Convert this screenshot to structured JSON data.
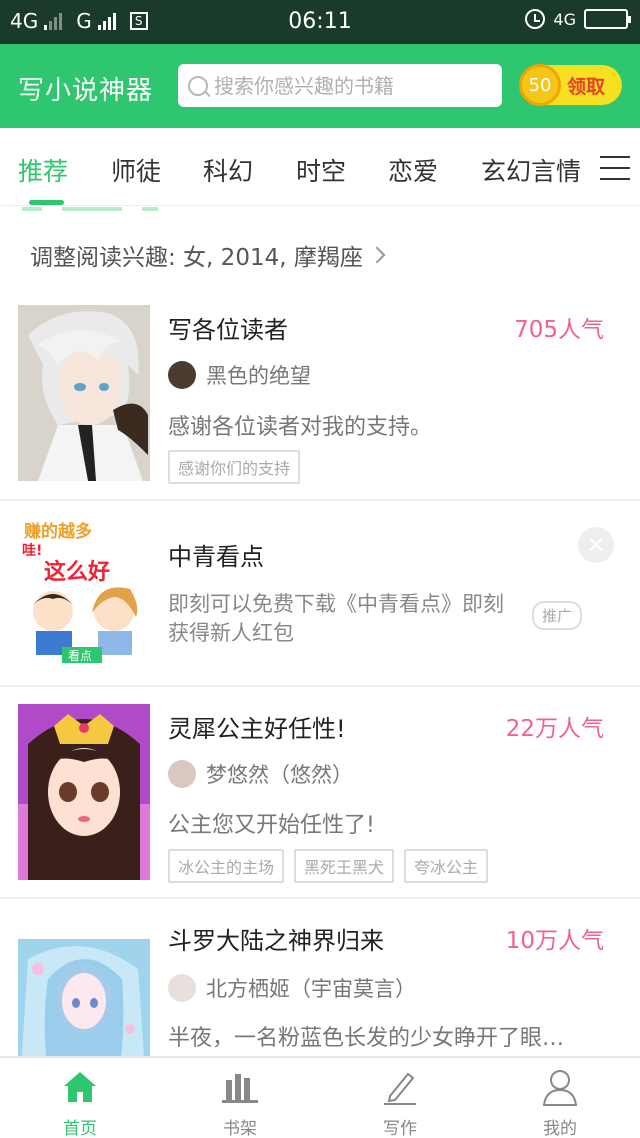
{
  "status_bar": {
    "left_network_1": "4G",
    "left_network_2": "G",
    "box_icon_text": "S",
    "time": "06:11",
    "right_network": "4G"
  },
  "header": {
    "app_title": "写小说神器",
    "search_placeholder": "搜索你感兴趣的书籍",
    "coin_value": "50",
    "reward_label": "领取",
    "accent_color": "#2ec66e"
  },
  "tabs": [
    "推荐",
    "师徒",
    "科幻",
    "时空",
    "恋爱",
    "玄幻言情"
  ],
  "active_tab": "推荐",
  "interest_prompt": "调整阅读兴趣: 女, 2014, 摩羯座",
  "books": [
    {
      "title": "写各位读者",
      "popularity": "705人气",
      "author": "黑色的绝望",
      "description": "感谢各位读者对我的支持。",
      "tags": [
        "感谢你们的支持"
      ]
    },
    {
      "title": "灵犀公主好任性!",
      "popularity": "22万人气",
      "author": "梦悠然（悠然）",
      "description": "公主您又开始任性了!",
      "tags": [
        "冰公主的主场",
        "黑死王黑犬",
        "夸冰公主"
      ]
    },
    {
      "title": "斗罗大陆之神界归来",
      "popularity": "10万人气",
      "author": "北方栖姬（宇宙莫言）",
      "description": "半夜，一名粉蓝色长发的少女睁开了眼…",
      "tags": []
    }
  ],
  "ad": {
    "title": "中青看点",
    "description": "即刻可以免费下载《中青看点》即刻获得新人红包",
    "badge": "推广",
    "image_text_1": "赚的越多",
    "image_text_2": "哇!",
    "image_text_3": "这么好",
    "image_text_4": "看点"
  },
  "bottom_nav": [
    {
      "label": "首页",
      "icon": "home-icon",
      "active": true
    },
    {
      "label": "书架",
      "icon": "bookshelf-icon",
      "active": false
    },
    {
      "label": "写作",
      "icon": "pen-icon",
      "active": false
    },
    {
      "label": "我的",
      "icon": "user-icon",
      "active": false
    }
  ]
}
